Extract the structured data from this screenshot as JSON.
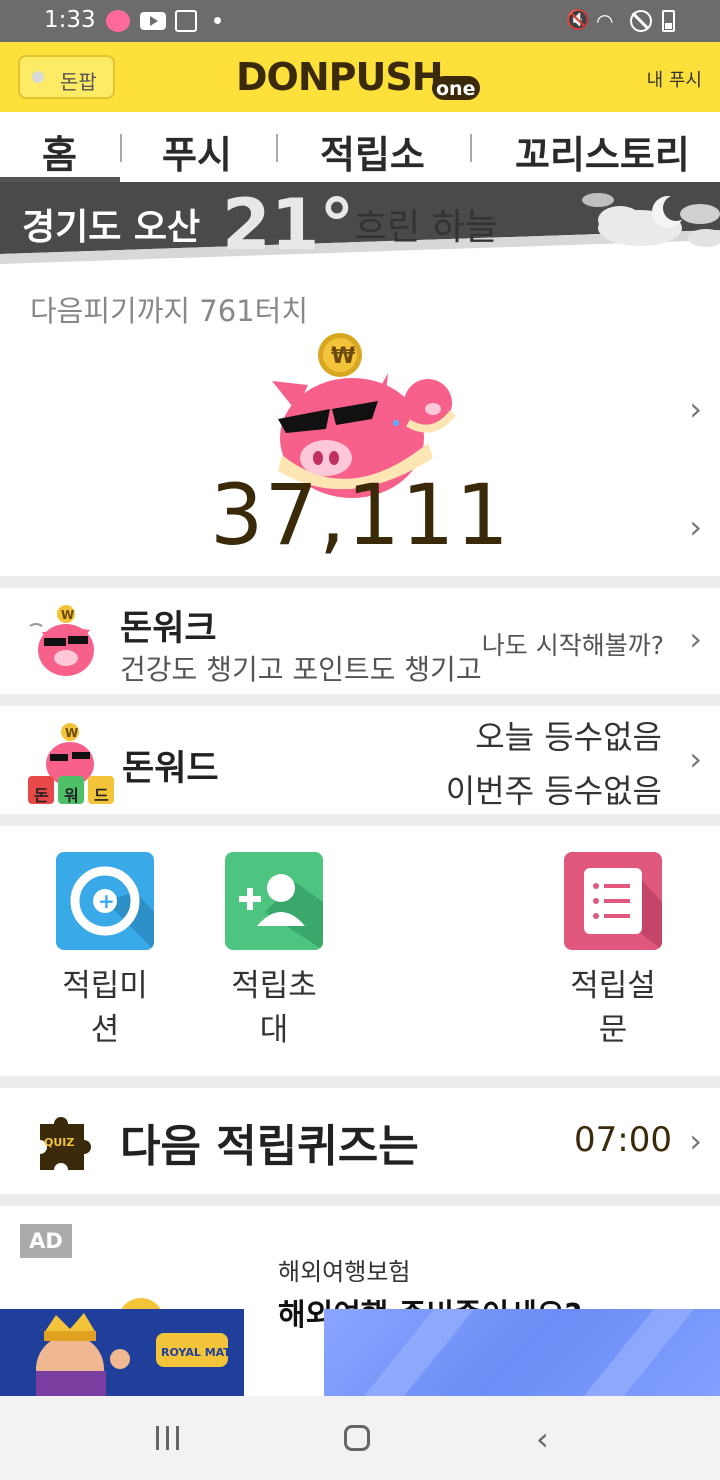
{
  "status_bar": {
    "time": "1:33"
  },
  "header": {
    "donpop_label": "돈팝",
    "logo_text": "DONPUSH",
    "logo_suffix": "one",
    "my_push": "내 푸시"
  },
  "tabs": [
    {
      "label": "홈",
      "active": true
    },
    {
      "label": "푸시"
    },
    {
      "label": "적립소"
    },
    {
      "label": "꼬리스토리"
    }
  ],
  "weather": {
    "location": "경기도 오산",
    "temperature": "21°",
    "description": "흐린 하늘"
  },
  "piggy": {
    "next_pig_text": "다음피기까지 761터치",
    "points": "37,111"
  },
  "donwalk": {
    "title": "돈워크",
    "subtitle": "건강도 챙기고 포인트도 챙기고",
    "cta": "나도 시작해볼까?"
  },
  "donword": {
    "title": "돈워드",
    "tiles": [
      "돈",
      "워",
      "드"
    ],
    "today": "오늘 등수없음",
    "this_week": "이번주 등수없음"
  },
  "grid": [
    {
      "label": "적립미션",
      "color": "#3aa9e8",
      "icon": "target-icon"
    },
    {
      "label": "적립초대",
      "color": "#4dc47f",
      "icon": "add-person-icon"
    },
    {
      "label": "적립설문",
      "color": "#e0587e",
      "icon": "list-icon"
    }
  ],
  "quiz": {
    "badge": "QUIZ",
    "title": "다음 적립퀴즈는",
    "time": "07:00"
  },
  "ad": {
    "badge": "AD",
    "category": "해외여행보험",
    "headline": "해외여행 준비중이세요?",
    "banner_text": "ROYAL MATCH!"
  },
  "colors": {
    "brand_yellow": "#fde03a",
    "points_text": "#3a2a0a",
    "pig_pink": "#f7608a"
  }
}
